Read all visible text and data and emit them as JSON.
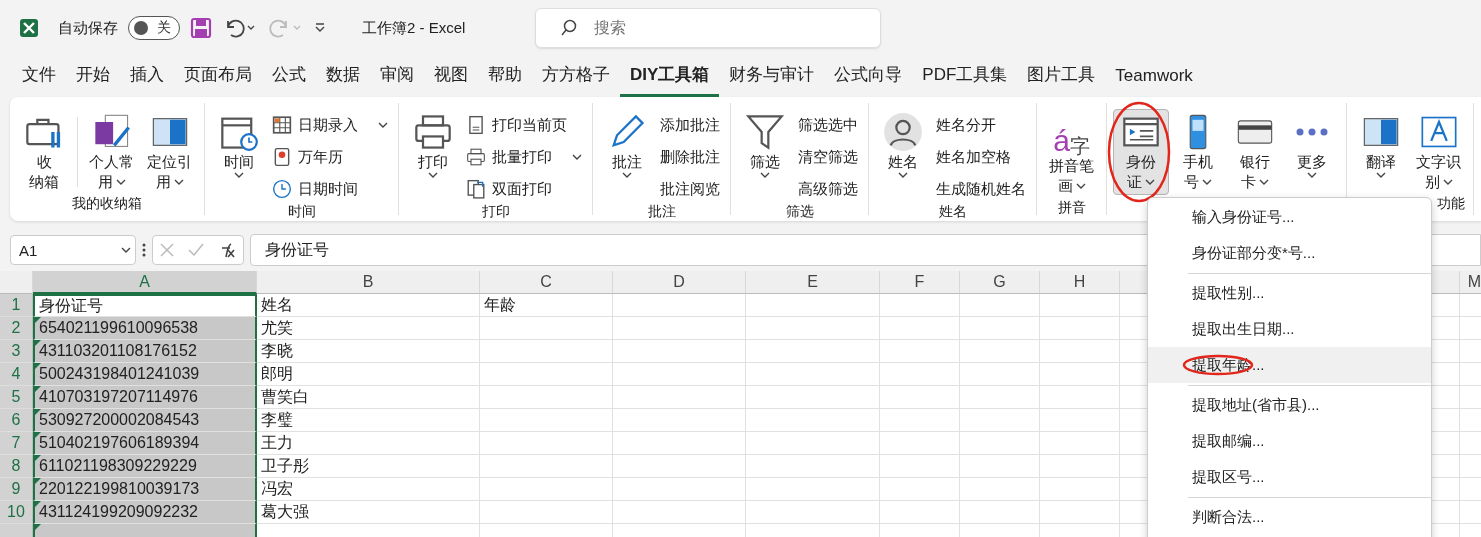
{
  "titlebar": {
    "autosave_label": "自动保存",
    "autosave": {
      "on": false,
      "label": "关"
    },
    "redo_disabled": true,
    "title": "工作簿2  -  Excel",
    "search": {
      "placeholder": "搜索"
    }
  },
  "tabs": [
    {
      "label": "文件",
      "selected": false
    },
    {
      "label": "开始",
      "selected": false
    },
    {
      "label": "插入",
      "selected": false
    },
    {
      "label": "页面布局",
      "selected": false
    },
    {
      "label": "公式",
      "selected": false
    },
    {
      "label": "数据",
      "selected": false
    },
    {
      "label": "审阅",
      "selected": false
    },
    {
      "label": "视图",
      "selected": false
    },
    {
      "label": "帮助",
      "selected": false
    },
    {
      "label": "方方格子",
      "selected": false
    },
    {
      "label": "DIY工具箱",
      "selected": true
    },
    {
      "label": "财务与审计",
      "selected": false
    },
    {
      "label": "公式向导",
      "selected": false
    },
    {
      "label": "PDF工具集",
      "selected": false
    },
    {
      "label": "图片工具",
      "selected": false
    },
    {
      "label": "Teamwork",
      "selected": false
    }
  ],
  "ribbon": [
    {
      "label": "我的收纳箱",
      "items": [
        {
          "kind": "large",
          "lines": [
            "收",
            "纳箱"
          ],
          "dropdown": false
        },
        {
          "kind": "separator"
        },
        {
          "kind": "large",
          "lines": [
            "个人常",
            "用"
          ],
          "dropdown": true
        },
        {
          "kind": "large",
          "lines": [
            "定位引",
            "用"
          ],
          "dropdown": true
        }
      ]
    },
    {
      "label": "时间",
      "items": [
        {
          "kind": "large",
          "lines": [
            "时间"
          ],
          "dropdown": true
        },
        {
          "kind": "column",
          "entries": [
            {
              "label": "日期录入",
              "dropdown": true
            },
            {
              "label": "万年历",
              "dropdown": false
            },
            {
              "label": "日期时间",
              "dropdown": false
            }
          ]
        }
      ]
    },
    {
      "label": "打印",
      "items": [
        {
          "kind": "large",
          "lines": [
            "打印"
          ],
          "dropdown": true
        },
        {
          "kind": "column",
          "entries": [
            {
              "label": "打印当前页",
              "dropdown": false
            },
            {
              "label": "批量打印",
              "dropdown": true
            },
            {
              "label": "双面打印",
              "dropdown": false
            }
          ]
        }
      ]
    },
    {
      "label": "批注",
      "items": [
        {
          "kind": "large",
          "lines": [
            "批注"
          ],
          "dropdown": true
        },
        {
          "kind": "column",
          "entries": [
            {
              "label": "添加批注",
              "dropdown": false
            },
            {
              "label": "删除批注",
              "dropdown": false
            },
            {
              "label": "批注阅览",
              "dropdown": false
            }
          ]
        }
      ]
    },
    {
      "label": "筛选",
      "items": [
        {
          "kind": "large",
          "lines": [
            "筛选"
          ],
          "dropdown": true
        },
        {
          "kind": "column",
          "entries": [
            {
              "label": "筛选选中",
              "dropdown": false
            },
            {
              "label": "清空筛选",
              "dropdown": false
            },
            {
              "label": "高级筛选",
              "dropdown": false
            }
          ]
        }
      ]
    },
    {
      "label": "姓名",
      "items": [
        {
          "kind": "large",
          "lines": [
            "姓名"
          ],
          "dropdown": true
        },
        {
          "kind": "column",
          "entries": [
            {
              "label": "姓名分开",
              "dropdown": false
            },
            {
              "label": "姓名加空格",
              "dropdown": false
            },
            {
              "label": "生成随机姓名",
              "dropdown": false
            }
          ]
        }
      ]
    },
    {
      "label": "拼音",
      "items": [
        {
          "kind": "large",
          "glyphs": [
            "á",
            "字"
          ],
          "lines": [
            "拼音笔",
            "画"
          ],
          "dropdown": true
        }
      ]
    },
    {
      "items": [
        {
          "kind": "large",
          "lines": [
            "身份",
            "证"
          ],
          "dropdown": true,
          "pressed": true,
          "circled": true
        },
        {
          "kind": "large",
          "lines": [
            "手机",
            "号"
          ],
          "dropdown": true
        },
        {
          "kind": "large",
          "lines": [
            "银行",
            "卡"
          ],
          "dropdown": true
        },
        {
          "kind": "large",
          "lines": [
            "更多"
          ],
          "dropdown": true
        }
      ]
    },
    {
      "label": "功能",
      "items": [
        {
          "kind": "large",
          "lines": [
            "翻译"
          ],
          "dropdown": true
        },
        {
          "kind": "large",
          "lines": [
            "文字识",
            "别"
          ],
          "dropdown": true
        }
      ]
    }
  ],
  "formula_bar": {
    "name_box": "A1",
    "value": "身份证号"
  },
  "sheet": {
    "columns": [
      {
        "label": "A",
        "selected": true
      },
      {
        "label": "B",
        "selected": false
      },
      {
        "label": "C",
        "selected": false
      },
      {
        "label": "D",
        "selected": false
      },
      {
        "label": "E",
        "selected": false
      },
      {
        "label": "F",
        "selected": false
      },
      {
        "label": "G",
        "selected": false
      },
      {
        "label": "H",
        "selected": false
      },
      {
        "label": "M",
        "selected": false
      }
    ],
    "rows": [
      {
        "number": "1",
        "selected": true,
        "cells": [
          "身份证号",
          "姓名",
          "年龄"
        ],
        "flag": false,
        "active": true
      },
      {
        "number": "2",
        "selected": true,
        "cells": [
          "654021199610096538",
          "尤笑"
        ],
        "flag": true,
        "active": false
      },
      {
        "number": "3",
        "selected": true,
        "cells": [
          "431103201108176152",
          "李晓"
        ],
        "flag": true,
        "active": false
      },
      {
        "number": "4",
        "selected": true,
        "cells": [
          "500243198401241039",
          "郎明"
        ],
        "flag": true,
        "active": false
      },
      {
        "number": "5",
        "selected": true,
        "cells": [
          "410703197207114976",
          "曹笑白"
        ],
        "flag": true,
        "active": false
      },
      {
        "number": "6",
        "selected": true,
        "cells": [
          "530927200002084543",
          "李璧"
        ],
        "flag": true,
        "active": false
      },
      {
        "number": "7",
        "selected": true,
        "cells": [
          "510402197606189394",
          "王力"
        ],
        "flag": true,
        "active": false
      },
      {
        "number": "8",
        "selected": true,
        "cells": [
          "611021198309229229",
          "卫子彤"
        ],
        "flag": true,
        "active": false
      },
      {
        "number": "9",
        "selected": true,
        "cells": [
          "220122199810039173",
          "冯宏"
        ],
        "flag": true,
        "active": false
      },
      {
        "number": "10",
        "selected": true,
        "cells": [
          "431124199209092232",
          "葛大强"
        ],
        "flag": true,
        "active": false
      },
      {
        "number": "",
        "selected": true,
        "cells": [],
        "flag": true,
        "active": false
      }
    ]
  },
  "menu": {
    "items": [
      {
        "kind": "item",
        "label": "输入身份证号...",
        "selected": false,
        "circled": false
      },
      {
        "kind": "item",
        "label": "身份证部分变*号...",
        "selected": false,
        "circled": false
      },
      {
        "kind": "separator"
      },
      {
        "kind": "item",
        "label": "提取性别...",
        "selected": false,
        "circled": false
      },
      {
        "kind": "item",
        "label": "提取出生日期...",
        "selected": false,
        "circled": false
      },
      {
        "kind": "item",
        "label": "提取年龄...",
        "selected": true,
        "circled": true
      },
      {
        "kind": "separator"
      },
      {
        "kind": "item",
        "label": "提取地址(省市县)...",
        "selected": false,
        "circled": false
      },
      {
        "kind": "item",
        "label": "提取邮编...",
        "selected": false,
        "circled": false
      },
      {
        "kind": "item",
        "label": "提取区号...",
        "selected": false,
        "circled": false
      },
      {
        "kind": "separator"
      },
      {
        "kind": "item",
        "label": "判断合法...",
        "selected": false,
        "circled": false
      }
    ]
  }
}
